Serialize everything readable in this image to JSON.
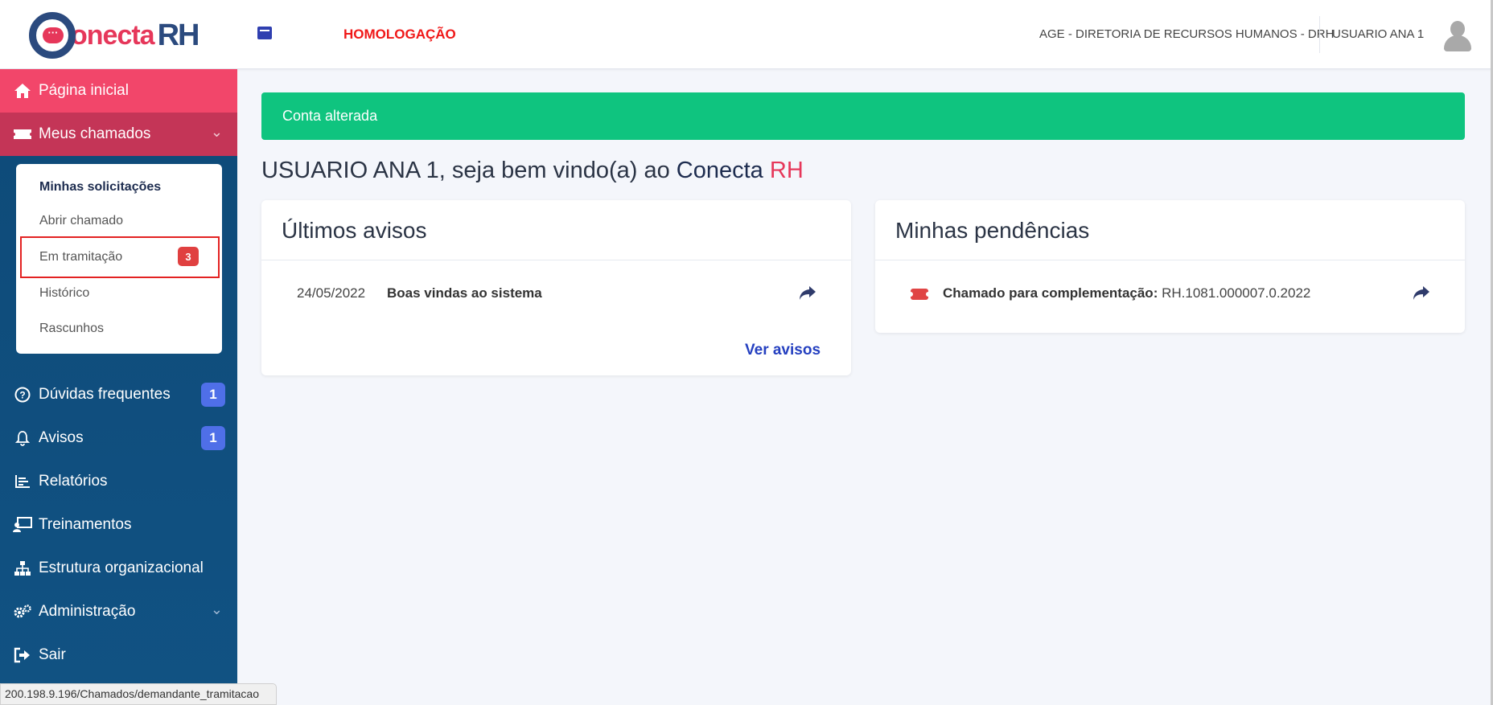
{
  "header": {
    "logo_word": "onecta",
    "logo_rh": "RH",
    "environment": "HOMOLOGAÇÃO",
    "organization": "AGE - DIRETORIA DE RECURSOS HUMANOS - DRH",
    "user_name": "USUARIO ANA 1"
  },
  "sidebar": {
    "home": "Página inicial",
    "meus_chamados": "Meus chamados",
    "submenu": {
      "minhas_solicitacoes": "Minhas solicitações",
      "abrir_chamado": "Abrir chamado",
      "em_tramitacao": "Em tramitação",
      "em_tramitacao_count": "3",
      "historico": "Histórico",
      "rascunhos": "Rascunhos"
    },
    "duvidas": "Dúvidas frequentes",
    "duvidas_count": "1",
    "avisos": "Avisos",
    "avisos_count": "1",
    "relatorios": "Relatórios",
    "treinamentos": "Treinamentos",
    "estrutura": "Estrutura organizacional",
    "administracao": "Administração",
    "sair": "Sair"
  },
  "status_url": "200.198.9.196/Chamados/demandante_tramitacao",
  "main": {
    "alert": "Conta alterada",
    "welcome_prefix": "USUARIO ANA 1, seja bem vindo(a) ao ",
    "welcome_brand": "Conecta",
    "welcome_rh": "RH",
    "avisos_card": {
      "title": "Últimos avisos",
      "items": [
        {
          "date": "24/05/2022",
          "title": "Boas vindas ao sistema"
        }
      ],
      "link": "Ver avisos"
    },
    "pendencias_card": {
      "title": "Minhas pendências",
      "items": [
        {
          "label": "Chamado para complementação:",
          "value": "RH.1081.000007.0.2022"
        }
      ]
    }
  }
}
